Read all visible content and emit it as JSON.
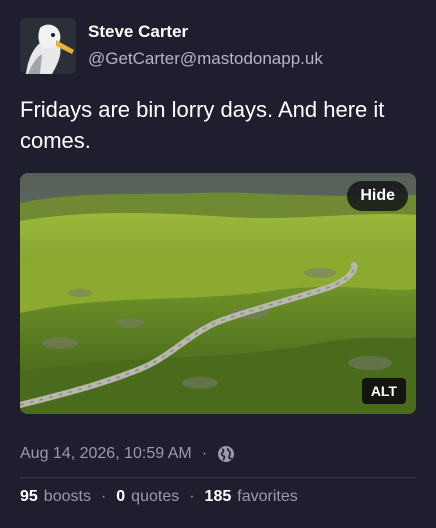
{
  "author": {
    "display_name": "Steve Carter",
    "handle": "@GetCarter@mastodonapp.uk"
  },
  "post": {
    "text": "Fridays are bin lorry days. And here it comes.",
    "media": {
      "hide_label": "Hide",
      "alt_label": "ALT"
    },
    "timestamp": "Aug 14, 2026, 10:59 AM",
    "separator": "·",
    "visibility_icon": "globe-icon"
  },
  "stats": {
    "boosts_count": "95",
    "boosts_label": "boosts",
    "quotes_count": "0",
    "quotes_label": "quotes",
    "favorites_count": "185",
    "favorites_label": "favorites",
    "separator": "·"
  },
  "colors": {
    "background": "#1f1e2e",
    "secondary_text": "#9b9ab0"
  }
}
